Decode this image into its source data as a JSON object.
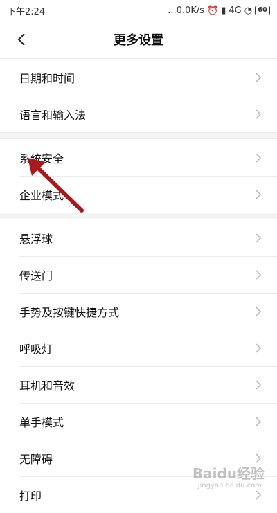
{
  "status_bar": {
    "time": "下午2:24",
    "network_speed": "...0.0K/s",
    "network_type": "4G",
    "battery": "60"
  },
  "header": {
    "title": "更多设置"
  },
  "sections": [
    {
      "items": [
        {
          "label": "日期和时间"
        },
        {
          "label": "语言和输入法"
        }
      ]
    },
    {
      "items": [
        {
          "label": "系统安全"
        },
        {
          "label": "企业模式"
        }
      ]
    },
    {
      "items": [
        {
          "label": "悬浮球"
        },
        {
          "label": "传送门"
        },
        {
          "label": "手势及按键快捷方式"
        },
        {
          "label": "呼吸灯"
        },
        {
          "label": "耳机和音效"
        },
        {
          "label": "单手模式"
        },
        {
          "label": "无障碍"
        },
        {
          "label": "打印"
        }
      ]
    }
  ],
  "annotation": {
    "arrow_color": "#a8191e"
  },
  "watermark": {
    "text": "Baidu经验",
    "sub": "jingyan.baidu.com"
  }
}
